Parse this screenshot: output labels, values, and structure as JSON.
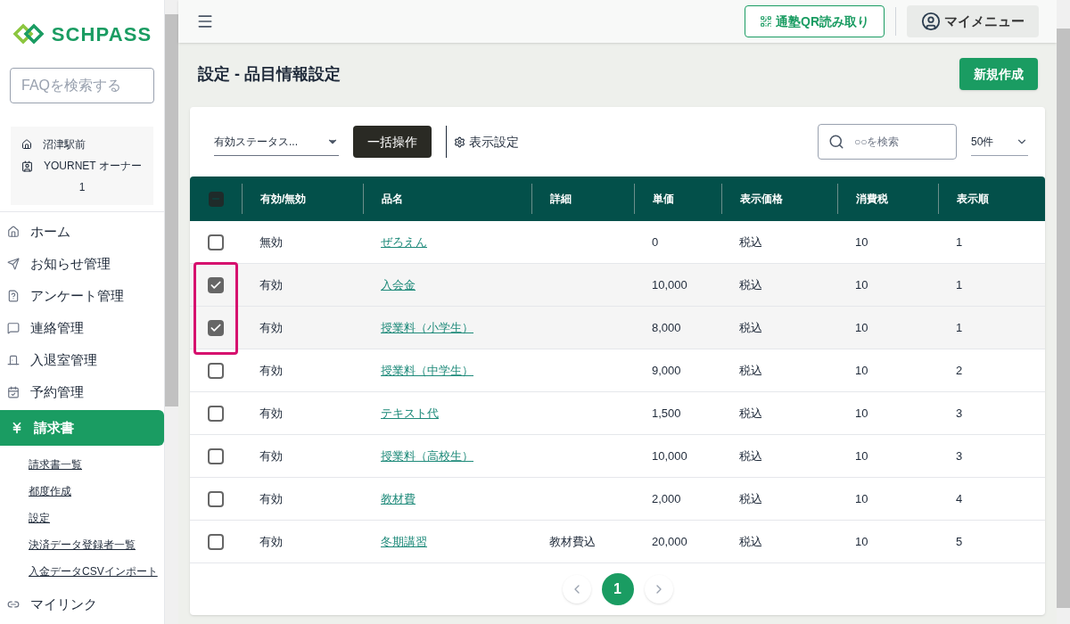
{
  "sidebar": {
    "logo": "SCHPASS",
    "faq_search": {
      "placeholder": "FAQを検索する"
    },
    "school": "沼津駅前",
    "user": "YOURNET オーナー",
    "user_number": "1",
    "items": [
      {
        "label": "ホーム",
        "kind": "home",
        "selected": false
      },
      {
        "label": "お知らせ管理",
        "kind": "send",
        "selected": false
      },
      {
        "label": "アンケート管理",
        "kind": "survey",
        "selected": false
      },
      {
        "label": "連絡管理",
        "kind": "chat",
        "selected": false
      },
      {
        "label": "入退室管理",
        "kind": "door",
        "selected": false
      },
      {
        "label": "予約管理",
        "kind": "calendar",
        "selected": false
      },
      {
        "label": "請求書",
        "kind": "billing",
        "selected": true,
        "children": [
          {
            "label": "請求書一覧"
          },
          {
            "label": "都度作成"
          },
          {
            "label": "設定"
          },
          {
            "label": "決済データ登録者一覧"
          },
          {
            "label": "入金データCSVインポート"
          }
        ]
      },
      {
        "label": "マイリンク",
        "kind": "link",
        "selected": false
      }
    ]
  },
  "header": {
    "qr_button": "通塾QR読み取り",
    "menu_button": "マイメニュー"
  },
  "page": {
    "title": "設定 - 品目情報設定",
    "new_button": "新規作成"
  },
  "toolbar": {
    "status_select": "有効ステータス...",
    "bulk_button": "一括操作",
    "display_settings": "表示設定",
    "search": {
      "placeholder": "○○を検索"
    },
    "per_page": "50件"
  },
  "table": {
    "select_all": {
      "indeterminate": true
    },
    "columns": [
      "有効/無効",
      "品名",
      "詳細",
      "単価",
      "表示価格",
      "消費税",
      "表示順"
    ],
    "rows": [
      {
        "checked": false,
        "cells": [
          "無効",
          "ぜろえん",
          "",
          "0",
          "税込",
          "10",
          "1"
        ]
      },
      {
        "checked": true,
        "cells": [
          "有効",
          "入会金",
          "",
          "10,000",
          "税込",
          "10",
          "1"
        ]
      },
      {
        "checked": true,
        "cells": [
          "有効",
          "授業料（小学生）",
          "",
          "8,000",
          "税込",
          "10",
          "1"
        ]
      },
      {
        "checked": false,
        "cells": [
          "有効",
          "授業料（中学生）",
          "",
          "9,000",
          "税込",
          "10",
          "2"
        ]
      },
      {
        "checked": false,
        "cells": [
          "有効",
          "テキスト代",
          "",
          "1,500",
          "税込",
          "10",
          "3"
        ]
      },
      {
        "checked": false,
        "cells": [
          "有効",
          "授業料（高校生）",
          "",
          "10,000",
          "税込",
          "10",
          "3"
        ]
      },
      {
        "checked": false,
        "cells": [
          "有効",
          "教材費",
          "",
          "2,000",
          "税込",
          "10",
          "4"
        ]
      },
      {
        "checked": false,
        "cells": [
          "有効",
          "冬期講習",
          "教材費込",
          "20,000",
          "税込",
          "10",
          "5"
        ]
      }
    ]
  },
  "pagination": {
    "pages": [
      {
        "label": "1",
        "selected": true
      }
    ]
  }
}
